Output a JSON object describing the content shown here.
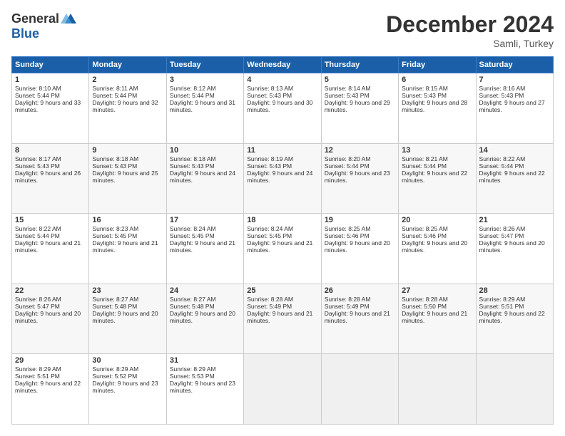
{
  "logo": {
    "line1": "General",
    "line2": "Blue"
  },
  "title": "December 2024",
  "subtitle": "Samli, Turkey",
  "days_header": [
    "Sunday",
    "Monday",
    "Tuesday",
    "Wednesday",
    "Thursday",
    "Friday",
    "Saturday"
  ],
  "weeks": [
    [
      {
        "day": "1",
        "sunrise": "Sunrise: 8:10 AM",
        "sunset": "Sunset: 5:44 PM",
        "daylight": "Daylight: 9 hours and 33 minutes."
      },
      {
        "day": "2",
        "sunrise": "Sunrise: 8:11 AM",
        "sunset": "Sunset: 5:44 PM",
        "daylight": "Daylight: 9 hours and 32 minutes."
      },
      {
        "day": "3",
        "sunrise": "Sunrise: 8:12 AM",
        "sunset": "Sunset: 5:44 PM",
        "daylight": "Daylight: 9 hours and 31 minutes."
      },
      {
        "day": "4",
        "sunrise": "Sunrise: 8:13 AM",
        "sunset": "Sunset: 5:43 PM",
        "daylight": "Daylight: 9 hours and 30 minutes."
      },
      {
        "day": "5",
        "sunrise": "Sunrise: 8:14 AM",
        "sunset": "Sunset: 5:43 PM",
        "daylight": "Daylight: 9 hours and 29 minutes."
      },
      {
        "day": "6",
        "sunrise": "Sunrise: 8:15 AM",
        "sunset": "Sunset: 5:43 PM",
        "daylight": "Daylight: 9 hours and 28 minutes."
      },
      {
        "day": "7",
        "sunrise": "Sunrise: 8:16 AM",
        "sunset": "Sunset: 5:43 PM",
        "daylight": "Daylight: 9 hours and 27 minutes."
      }
    ],
    [
      {
        "day": "8",
        "sunrise": "Sunrise: 8:17 AM",
        "sunset": "Sunset: 5:43 PM",
        "daylight": "Daylight: 9 hours and 26 minutes."
      },
      {
        "day": "9",
        "sunrise": "Sunrise: 8:18 AM",
        "sunset": "Sunset: 5:43 PM",
        "daylight": "Daylight: 9 hours and 25 minutes."
      },
      {
        "day": "10",
        "sunrise": "Sunrise: 8:18 AM",
        "sunset": "Sunset: 5:43 PM",
        "daylight": "Daylight: 9 hours and 24 minutes."
      },
      {
        "day": "11",
        "sunrise": "Sunrise: 8:19 AM",
        "sunset": "Sunset: 5:43 PM",
        "daylight": "Daylight: 9 hours and 24 minutes."
      },
      {
        "day": "12",
        "sunrise": "Sunrise: 8:20 AM",
        "sunset": "Sunset: 5:44 PM",
        "daylight": "Daylight: 9 hours and 23 minutes."
      },
      {
        "day": "13",
        "sunrise": "Sunrise: 8:21 AM",
        "sunset": "Sunset: 5:44 PM",
        "daylight": "Daylight: 9 hours and 22 minutes."
      },
      {
        "day": "14",
        "sunrise": "Sunrise: 8:22 AM",
        "sunset": "Sunset: 5:44 PM",
        "daylight": "Daylight: 9 hours and 22 minutes."
      }
    ],
    [
      {
        "day": "15",
        "sunrise": "Sunrise: 8:22 AM",
        "sunset": "Sunset: 5:44 PM",
        "daylight": "Daylight: 9 hours and 21 minutes."
      },
      {
        "day": "16",
        "sunrise": "Sunrise: 8:23 AM",
        "sunset": "Sunset: 5:45 PM",
        "daylight": "Daylight: 9 hours and 21 minutes."
      },
      {
        "day": "17",
        "sunrise": "Sunrise: 8:24 AM",
        "sunset": "Sunset: 5:45 PM",
        "daylight": "Daylight: 9 hours and 21 minutes."
      },
      {
        "day": "18",
        "sunrise": "Sunrise: 8:24 AM",
        "sunset": "Sunset: 5:45 PM",
        "daylight": "Daylight: 9 hours and 21 minutes."
      },
      {
        "day": "19",
        "sunrise": "Sunrise: 8:25 AM",
        "sunset": "Sunset: 5:46 PM",
        "daylight": "Daylight: 9 hours and 20 minutes."
      },
      {
        "day": "20",
        "sunrise": "Sunrise: 8:25 AM",
        "sunset": "Sunset: 5:46 PM",
        "daylight": "Daylight: 9 hours and 20 minutes."
      },
      {
        "day": "21",
        "sunrise": "Sunrise: 8:26 AM",
        "sunset": "Sunset: 5:47 PM",
        "daylight": "Daylight: 9 hours and 20 minutes."
      }
    ],
    [
      {
        "day": "22",
        "sunrise": "Sunrise: 8:26 AM",
        "sunset": "Sunset: 5:47 PM",
        "daylight": "Daylight: 9 hours and 20 minutes."
      },
      {
        "day": "23",
        "sunrise": "Sunrise: 8:27 AM",
        "sunset": "Sunset: 5:48 PM",
        "daylight": "Daylight: 9 hours and 20 minutes."
      },
      {
        "day": "24",
        "sunrise": "Sunrise: 8:27 AM",
        "sunset": "Sunset: 5:48 PM",
        "daylight": "Daylight: 9 hours and 20 minutes."
      },
      {
        "day": "25",
        "sunrise": "Sunrise: 8:28 AM",
        "sunset": "Sunset: 5:49 PM",
        "daylight": "Daylight: 9 hours and 21 minutes."
      },
      {
        "day": "26",
        "sunrise": "Sunrise: 8:28 AM",
        "sunset": "Sunset: 5:49 PM",
        "daylight": "Daylight: 9 hours and 21 minutes."
      },
      {
        "day": "27",
        "sunrise": "Sunrise: 8:28 AM",
        "sunset": "Sunset: 5:50 PM",
        "daylight": "Daylight: 9 hours and 21 minutes."
      },
      {
        "day": "28",
        "sunrise": "Sunrise: 8:29 AM",
        "sunset": "Sunset: 5:51 PM",
        "daylight": "Daylight: 9 hours and 22 minutes."
      }
    ],
    [
      {
        "day": "29",
        "sunrise": "Sunrise: 8:29 AM",
        "sunset": "Sunset: 5:51 PM",
        "daylight": "Daylight: 9 hours and 22 minutes."
      },
      {
        "day": "30",
        "sunrise": "Sunrise: 8:29 AM",
        "sunset": "Sunset: 5:52 PM",
        "daylight": "Daylight: 9 hours and 23 minutes."
      },
      {
        "day": "31",
        "sunrise": "Sunrise: 8:29 AM",
        "sunset": "Sunset: 5:53 PM",
        "daylight": "Daylight: 9 hours and 23 minutes."
      },
      null,
      null,
      null,
      null
    ]
  ]
}
